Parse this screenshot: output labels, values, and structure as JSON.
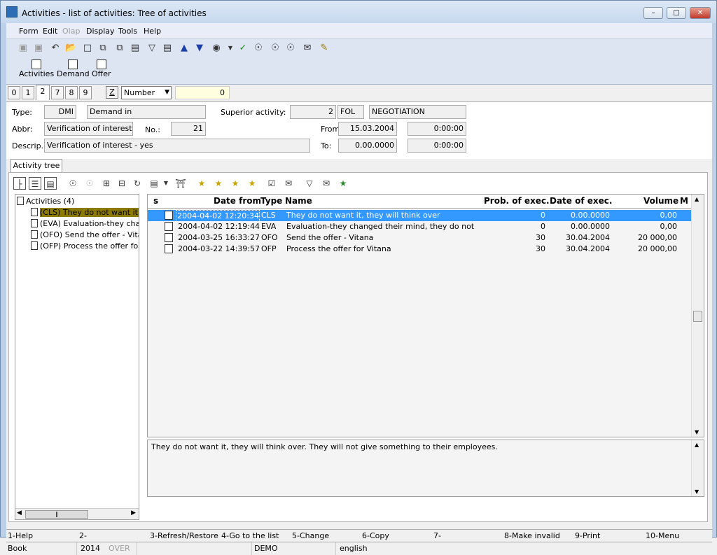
{
  "window": {
    "title": "Activities - list of activities: Tree of activities"
  },
  "menu": [
    "Form",
    "Edit",
    "Olap",
    "Display",
    "Tools",
    "Help"
  ],
  "bigbar": [
    "Activities",
    "Demand",
    "Offer"
  ],
  "tabs": [
    "0",
    "1",
    "2",
    "7",
    "8",
    "9"
  ],
  "filter": {
    "z": "Z",
    "field": "Number",
    "value": "0"
  },
  "form": {
    "type_label": "Type:",
    "type_code": "DMI",
    "type_name": "Demand in",
    "superior_label": "Superior activity:",
    "superior_no": "2",
    "superior_code": "FOL",
    "superior_name": "NEGOTIATION",
    "abbr_label": "Abbr:",
    "abbr_value": "Verification of interest - yes",
    "no_label": "No.:",
    "no_value": "21",
    "from_label": "From:",
    "from_date": "15.03.2004",
    "from_time": "0:00:00",
    "descrip_label": "Descrip.:",
    "descrip_value": "Verification of interest - yes",
    "to_label": "To:",
    "to_date": "0.00.0000",
    "to_time": "0:00:00"
  },
  "tree_tab": "Activity tree",
  "tree": {
    "root": "Activities (4)",
    "items": [
      "(CLS) They do not want it, they will think over",
      "(EVA) Evaluation-they changed their mind, they do not want it",
      "(OFO) Send the offer - Vitana",
      "(OFP) Process the offer for Vitana"
    ]
  },
  "grid": {
    "headers": [
      "s",
      "Date from",
      "Type",
      "Name",
      "Prob. of exec.",
      "Date of exec.",
      "Volume",
      "M"
    ],
    "rows": [
      {
        "date": "2004-04-02 12:20:34",
        "type": "CLS",
        "name": "They do not want it, they will think over",
        "prob": "0",
        "exec": "0.00.0000",
        "volume": "0,00"
      },
      {
        "date": "2004-04-02 12:19:44",
        "type": "EVA",
        "name": "Evaluation-they changed their mind, they do not want it",
        "prob": "0",
        "exec": "0.00.0000",
        "volume": "0,00"
      },
      {
        "date": "2004-03-25 16:33:27",
        "type": "OFO",
        "name": "Send the offer - Vitana",
        "prob": "30",
        "exec": "30.04.2004",
        "volume": "20 000,00"
      },
      {
        "date": "2004-03-22 14:39:57",
        "type": "OFP",
        "name": "Process the offer for Vitana",
        "prob": "30",
        "exec": "30.04.2004",
        "volume": "20 000,00"
      }
    ]
  },
  "note": "They do not want it, they will think over. They will not give something to their employees.",
  "fkeys": [
    "1-Help",
    "2-",
    "3-Refresh/Restore",
    "4-Go to the list",
    "5-Change",
    "6-Copy",
    "7-",
    "8-Make invalid",
    "9-Print",
    "10-Menu"
  ],
  "status": {
    "book": "Book",
    "year": "2014",
    "over": "OVER",
    "db": "DEMO",
    "lang": "english"
  }
}
